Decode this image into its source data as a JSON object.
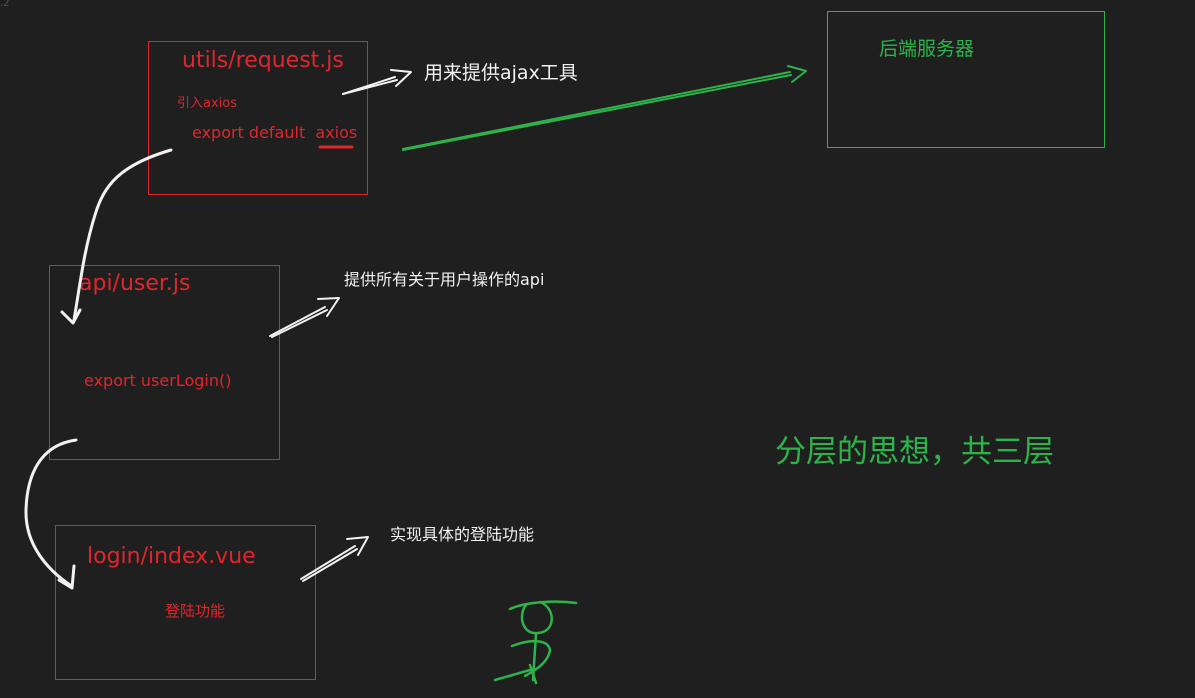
{
  "colors": {
    "background": "#1f1f1f",
    "red": "#e0262c",
    "green": "#2db34a",
    "white": "#f2f2f2"
  },
  "corner_text": ".2",
  "boxes": {
    "request": {
      "title": "utils/request.js",
      "line1": "引入axios",
      "line2_prefix": "export default",
      "line2_emphasis": "axios"
    },
    "user": {
      "title": "api/user.js",
      "line1": "export userLogin()"
    },
    "login": {
      "title": "login/index.vue",
      "line1": "登陆功能"
    },
    "server": {
      "title": "后端服务器"
    }
  },
  "annotations": {
    "request_desc": "用来提供ajax工具",
    "user_desc": "提供所有关于用户操作的api",
    "login_desc": "实现具体的登陆功能"
  },
  "headline": "分层的思想，共三层"
}
